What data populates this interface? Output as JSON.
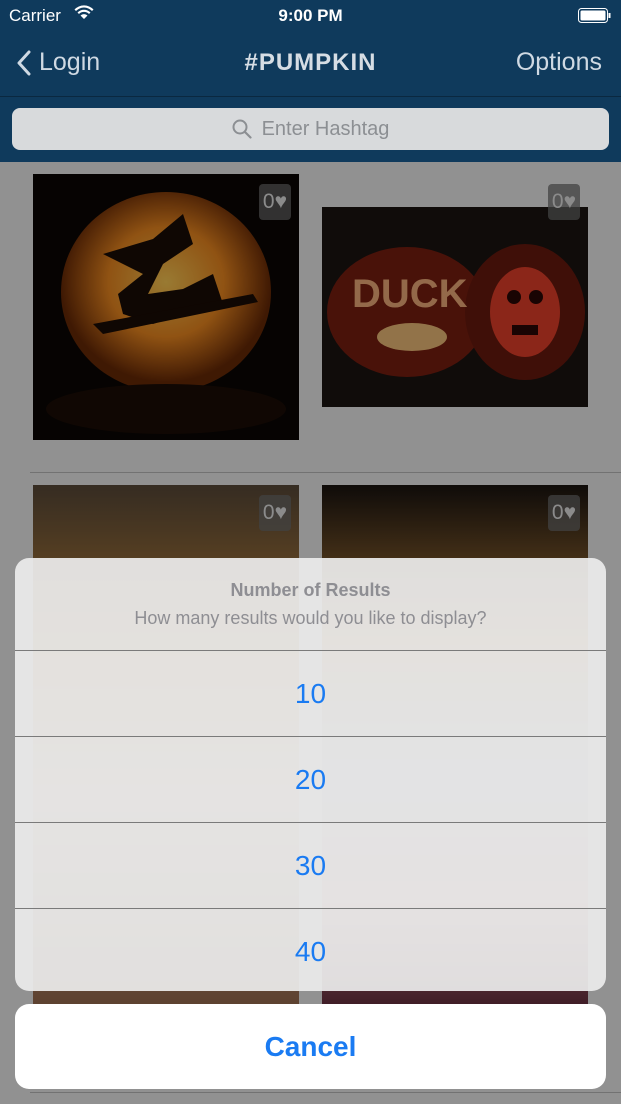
{
  "status_bar": {
    "carrier": "Carrier",
    "time": "9:00 PM"
  },
  "nav": {
    "back_label": "Login",
    "title": "#PUMPKIN",
    "options_label": "Options"
  },
  "search": {
    "placeholder": "Enter Hashtag"
  },
  "photos": [
    {
      "likes": "0♥",
      "desc": "witch pumpkin"
    },
    {
      "likes": "0♥",
      "desc": "duck and skull pumpkins"
    },
    {
      "likes": "0♥",
      "desc": "pumpkin photo"
    },
    {
      "likes": "0♥",
      "desc": "pumpkin photo"
    }
  ],
  "action_sheet": {
    "title": "Number of Results",
    "message": "How many results would you like to display?",
    "options": [
      "10",
      "20",
      "30",
      "40"
    ],
    "cancel": "Cancel"
  },
  "colors": {
    "nav_bg": "#0f3a5c",
    "accent": "#1a7bf2"
  }
}
